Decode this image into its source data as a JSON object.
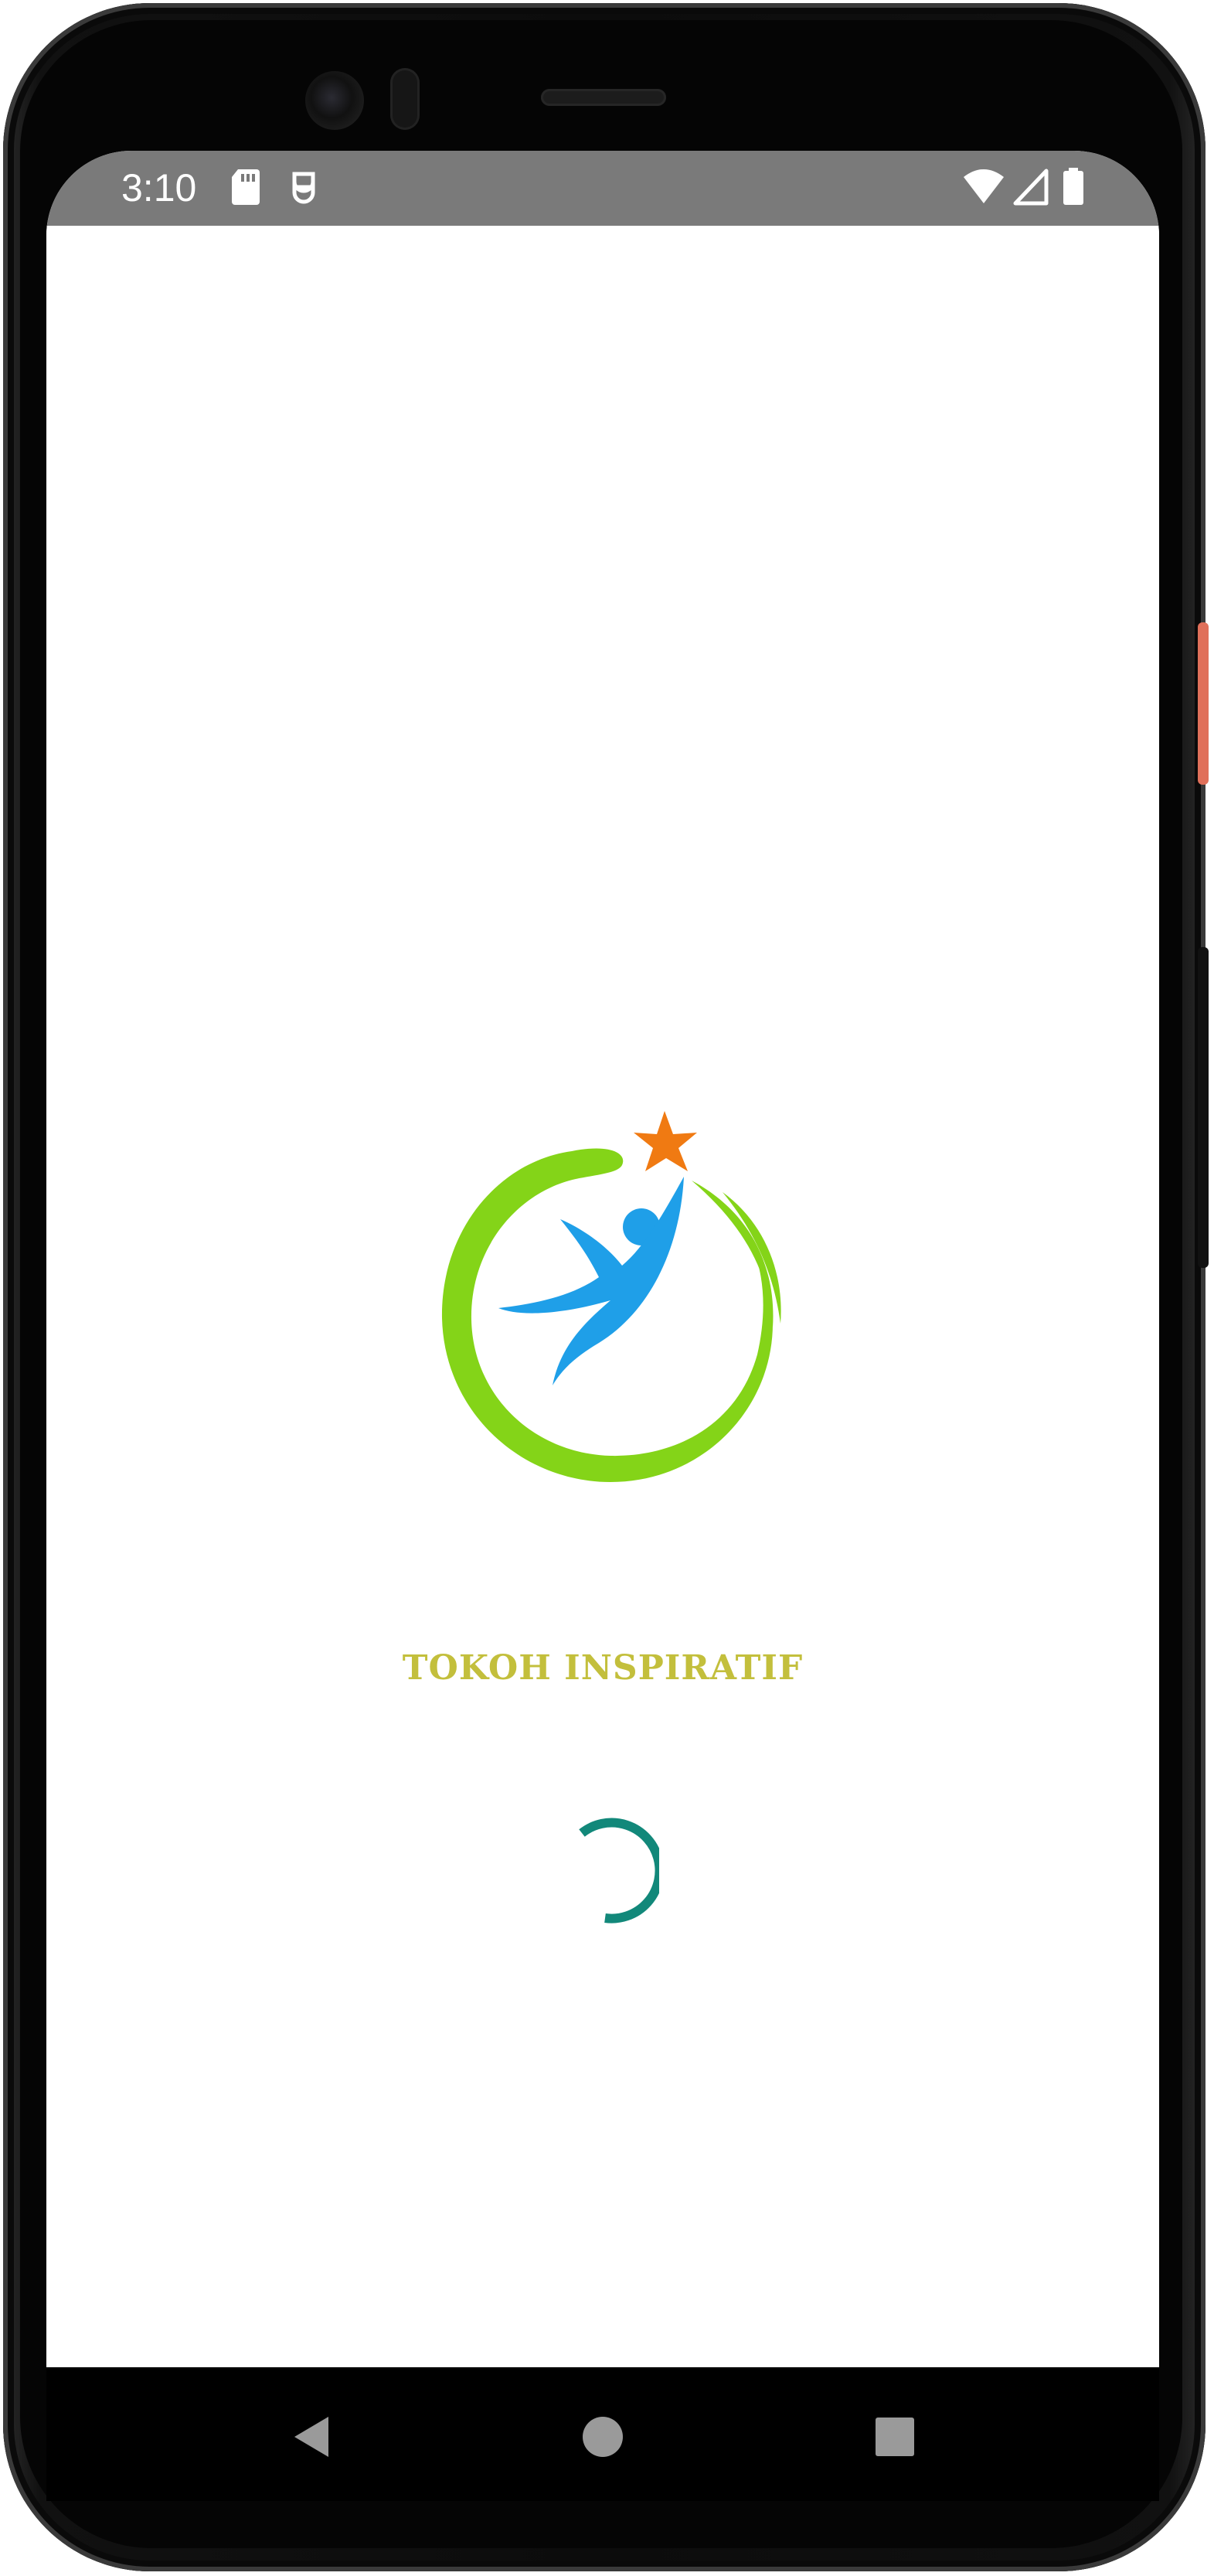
{
  "status_bar": {
    "time": "3:10",
    "left_icons": [
      "sd-card-icon",
      "debug-icon"
    ],
    "right_icons": [
      "wifi-icon",
      "cellular-signal-icon",
      "battery-icon"
    ],
    "background_color": "#7a7a7a"
  },
  "app": {
    "title": "TOKOH INSPIRATIF",
    "title_color": "#c3bf3c",
    "logo_icon": "tokoh-inspiratif-logo",
    "logo_colors": {
      "ring": "#84d418",
      "figure": "#1f9fe8",
      "star": "#f07a12"
    },
    "spinner_color": "#12887a"
  },
  "navigation": {
    "back": "back-icon",
    "home": "home-icon",
    "recents": "recents-icon",
    "button_color": "#9a9a9a"
  }
}
